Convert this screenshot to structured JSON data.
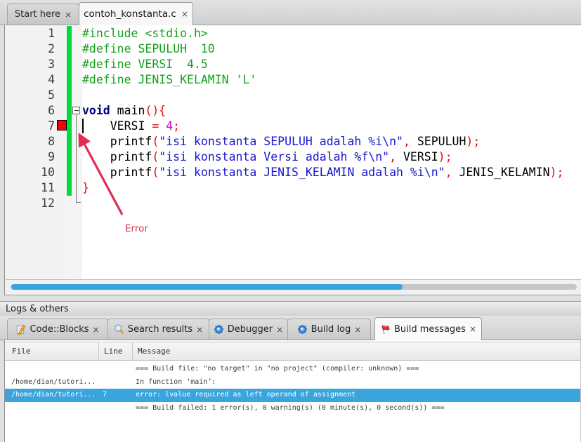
{
  "ui": {
    "close_glyph": "×"
  },
  "editor_tabs": {
    "start_here": {
      "label": "Start here"
    },
    "active_file": {
      "label": "contoh_konstanta.c"
    }
  },
  "editor": {
    "annotation_label": "Error",
    "lines": [
      {
        "num": "1",
        "segments": [
          {
            "text": "#include <stdio.h>",
            "style": "preproc"
          }
        ]
      },
      {
        "num": "2",
        "segments": [
          {
            "text": "#define SEPULUH  10",
            "style": "preproc"
          }
        ]
      },
      {
        "num": "3",
        "segments": [
          {
            "text": "#define VERSI  4.5",
            "style": "preproc"
          }
        ]
      },
      {
        "num": "4",
        "segments": [
          {
            "text": "#define JENIS_KELAMIN 'L'",
            "style": "preproc"
          }
        ]
      },
      {
        "num": "5",
        "segments": []
      },
      {
        "num": "6",
        "segments": [
          {
            "text": "void",
            "style": "kw"
          },
          {
            "text": " main",
            "style": "plain"
          },
          {
            "text": "(){",
            "style": "op"
          }
        ]
      },
      {
        "num": "7",
        "segments": [
          {
            "text": "    VERSI ",
            "style": "plain"
          },
          {
            "text": "= ",
            "style": "op"
          },
          {
            "text": "4",
            "style": "num"
          },
          {
            "text": ";",
            "style": "op"
          }
        ]
      },
      {
        "num": "8",
        "segments": [
          {
            "text": "    printf",
            "style": "plain"
          },
          {
            "text": "(",
            "style": "op"
          },
          {
            "text": "\"isi konstanta SEPULUH adalah %i\\n\"",
            "style": "str"
          },
          {
            "text": ",",
            "style": "op"
          },
          {
            "text": " SEPULUH",
            "style": "plain"
          },
          {
            "text": ");",
            "style": "op"
          }
        ]
      },
      {
        "num": "9",
        "segments": [
          {
            "text": "    printf",
            "style": "plain"
          },
          {
            "text": "(",
            "style": "op"
          },
          {
            "text": "\"isi konstanta Versi adalah %f\\n\"",
            "style": "str"
          },
          {
            "text": ",",
            "style": "op"
          },
          {
            "text": " VERSI",
            "style": "plain"
          },
          {
            "text": ");",
            "style": "op"
          }
        ]
      },
      {
        "num": "10",
        "segments": [
          {
            "text": "    printf",
            "style": "plain"
          },
          {
            "text": "(",
            "style": "op"
          },
          {
            "text": "\"isi konstanta JENIS_KELAMIN adalah %i\\n\"",
            "style": "str"
          },
          {
            "text": ",",
            "style": "op"
          },
          {
            "text": " JENIS_KELAMIN",
            "style": "plain"
          },
          {
            "text": ");",
            "style": "op"
          }
        ]
      },
      {
        "num": "11",
        "segments": [
          {
            "text": "}",
            "style": "op"
          }
        ]
      },
      {
        "num": "12",
        "segments": []
      }
    ]
  },
  "logs_panel": {
    "caption": "Logs & others",
    "tabs": [
      {
        "label": "Code::Blocks",
        "icon": "notepad-pencil"
      },
      {
        "label": "Search results",
        "icon": "magnifier"
      },
      {
        "label": "Debugger",
        "icon": "blue-gear"
      },
      {
        "label": "Build log",
        "icon": "blue-gear"
      },
      {
        "label": "Build messages",
        "icon": "red-flag"
      }
    ],
    "table": {
      "columns": {
        "file": "File",
        "line": "Line",
        "message": "Message"
      },
      "rows": [
        {
          "file": "",
          "line": "",
          "message": "=== Build file: \"no target\" in \"no project\" (compiler: unknown) ==="
        },
        {
          "file": "/home/dian/tutori...",
          "line": "",
          "message": "In function ‘main’:"
        },
        {
          "file": "/home/dian/tutori...",
          "line": "7",
          "message": "error: lvalue required as left operand of assignment"
        },
        {
          "file": "",
          "line": "",
          "message": "=== Build failed: 1 error(s), 0 warning(s) (0 minute(s), 0 second(s)) ==="
        }
      ]
    }
  },
  "colors": {
    "accent_blue": "#3aa4dc",
    "change_bar_green": "#00db3e",
    "error_marker_red": "#f00404",
    "arrow_crimson": "#dd2e4e",
    "preprocessor_green": "#15a21f",
    "keyword_navy": "#000080",
    "string_blue": "#1616d1",
    "operator_red": "#dc0c0c",
    "number_magenta": "#cc00cc"
  }
}
